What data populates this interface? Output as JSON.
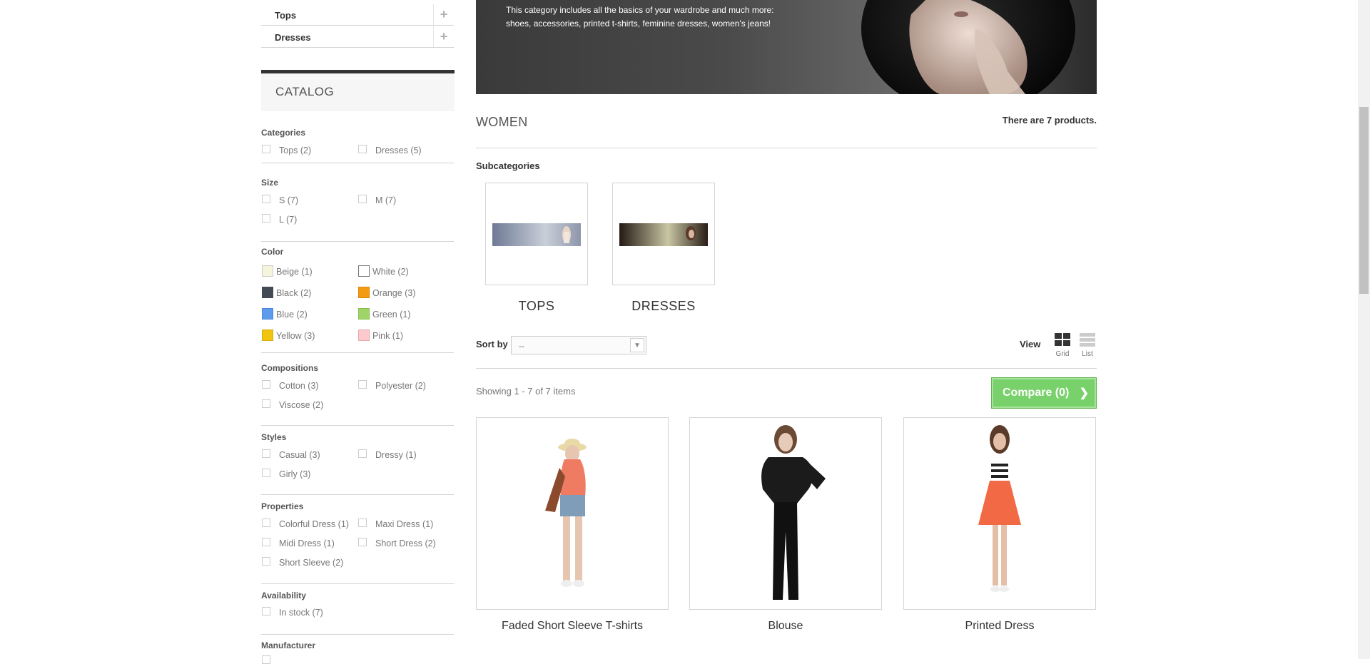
{
  "sidebar": {
    "category_rows": [
      {
        "label": "Tops",
        "expand": "+"
      },
      {
        "label": "Dresses",
        "expand": "+"
      }
    ],
    "catalog_title": "CATALOG",
    "filters": {
      "categories": {
        "title": "Categories",
        "options": [
          "Tops (2)",
          "Dresses (5)"
        ]
      },
      "size": {
        "title": "Size",
        "options": [
          "S (7)",
          "M (7)",
          "L (7)"
        ]
      },
      "color": {
        "title": "Color",
        "options": [
          {
            "label": "Beige (1)",
            "color": "#f5f5dc"
          },
          {
            "label": "White (2)",
            "color": "#ffffff"
          },
          {
            "label": "Black (2)",
            "color": "#434a54"
          },
          {
            "label": "Orange (3)",
            "color": "#f39c11"
          },
          {
            "label": "Blue (2)",
            "color": "#5d9cec"
          },
          {
            "label": "Green (1)",
            "color": "#a0d468"
          },
          {
            "label": "Yellow (3)",
            "color": "#f1c40f"
          },
          {
            "label": "Pink (1)",
            "color": "#fccacd"
          }
        ]
      },
      "compositions": {
        "title": "Compositions",
        "options": [
          "Cotton (3)",
          "Polyester (2)",
          "Viscose (2)"
        ]
      },
      "styles": {
        "title": "Styles",
        "options": [
          "Casual (3)",
          "Dressy (1)",
          "Girly (3)"
        ]
      },
      "properties": {
        "title": "Properties",
        "options": [
          "Colorful Dress (1)",
          "Maxi Dress (1)",
          "Midi Dress (1)",
          "Short Dress (2)",
          "Short Sleeve (2)"
        ]
      },
      "availability": {
        "title": "Availability",
        "options": [
          "In stock (7)"
        ]
      },
      "manufacturer": {
        "title": "Manufacturer"
      }
    }
  },
  "hero": {
    "line1": "This category includes all the basics of your wardrobe and much more:",
    "line2": "shoes, accessories, printed t-shirts, feminine dresses, women's jeans!"
  },
  "category": {
    "name": "WOMEN",
    "product_count": "There are 7 products."
  },
  "subcategories": {
    "title": "Subcategories",
    "items": [
      {
        "name": "TOPS"
      },
      {
        "name": "DRESSES"
      }
    ]
  },
  "toolbar": {
    "sort_label": "Sort by",
    "sort_value": "--",
    "view_label": "View",
    "grid_label": "Grid",
    "list_label": "List",
    "showing": "Showing 1 - 7 of 7 items",
    "compare_label": "Compare (0)"
  },
  "products": [
    {
      "name": "Faded Short Sleeve T-shirts"
    },
    {
      "name": "Blouse"
    },
    {
      "name": "Printed Dress"
    }
  ],
  "colors": {
    "accent_green": "#78d16a",
    "border": "#d6d4d4",
    "catalog_top_border": "#333333"
  }
}
